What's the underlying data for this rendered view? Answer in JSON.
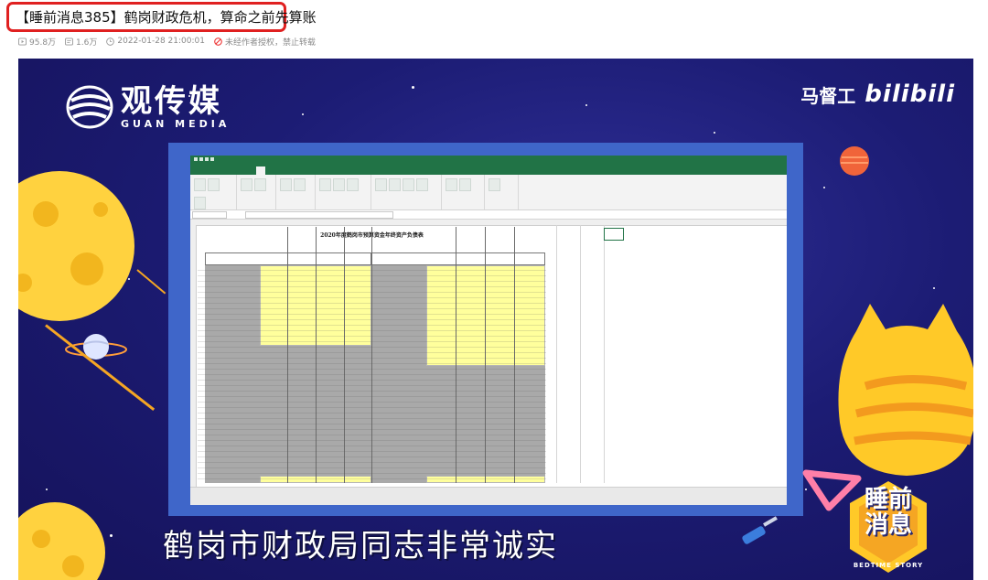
{
  "post": {
    "title": "【睡前消息385】鹤岗财政危机，算命之前先算账",
    "views": "95.8万",
    "danmaku": "1.6万",
    "datetime": "2022-01-28 21:00:01",
    "copyright": "未经作者授权，禁止转载"
  },
  "video": {
    "logo_cn": "观传媒",
    "logo_en": "GUAN MEDIA",
    "watermark_name": "马督工",
    "watermark_brand": "bilibili",
    "caption": "鹤岗市财政局同志非常诚实",
    "badge_text_line1": "睡前",
    "badge_text_line2": "消息",
    "badge_sub": "BEDTIME STORY"
  },
  "spreadsheet": {
    "title": "2020年度鹤岗市预算资金年终资产负债表"
  },
  "colors": {
    "highlight_border": "#e02020",
    "video_bg": "#1c1c74",
    "excel_green": "#217346",
    "frame_blue": "#3f66c9",
    "yellow_cells": "#ffff9c",
    "gray_cells": "#a9a9a9"
  },
  "icons": [
    "play-count-icon",
    "danmaku-icon",
    "clock-icon",
    "no-reprint-icon"
  ]
}
